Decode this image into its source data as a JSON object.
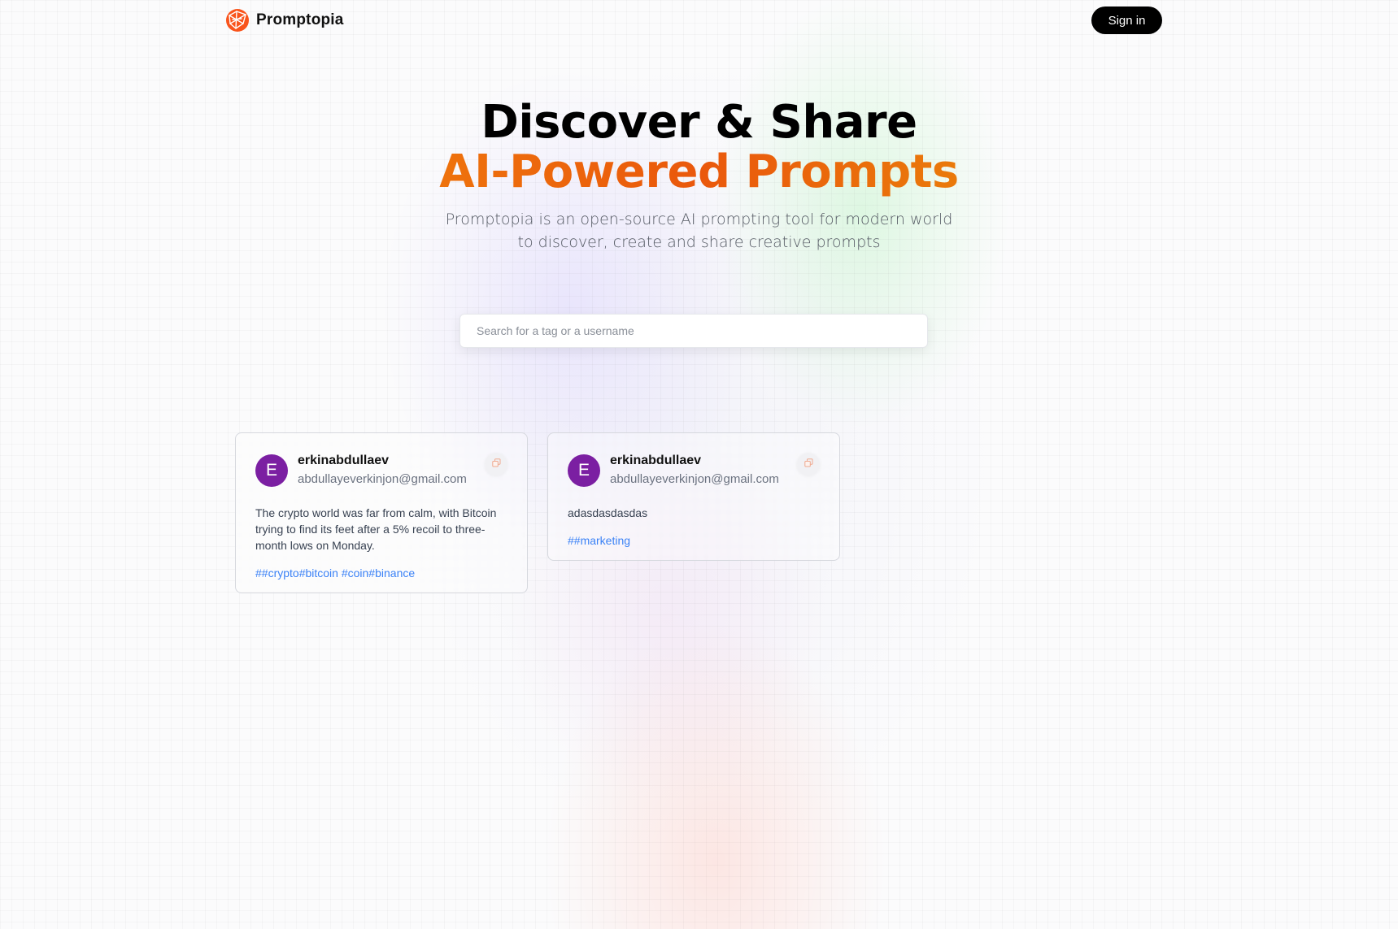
{
  "nav": {
    "brand_name": "Promptopia",
    "logo_icon": "logo-icon",
    "signin_label": "Sign in"
  },
  "hero": {
    "title_line1": "Discover & Share",
    "title_line2": "AI-Powered Prompts",
    "description": "Promptopia is an open-source AI prompting tool for modern world to discover, create and share creative prompts"
  },
  "search": {
    "placeholder": "Search for a tag or a username",
    "value": ""
  },
  "prompts": [
    {
      "avatar_initial": "E",
      "username": "erkinabdullaev",
      "email": "abdullayeverkinjon@gmail.com",
      "prompt": "The crypto world was far from calm, with Bitcoin trying to find its feet after a 5% recoil to three-month lows on Monday.",
      "tags": "##crypto#bitcoin #coin#binance",
      "copy_icon": "copy-icon"
    },
    {
      "avatar_initial": "E",
      "username": "erkinabdullaev",
      "email": "abdullayeverkinjon@gmail.com",
      "prompt": "adasdasdasdas",
      "tags": "##marketing",
      "copy_icon": "copy-icon"
    }
  ],
  "colors": {
    "accent_gradient_start": "#f59e0b",
    "accent_gradient_mid": "#ea580c",
    "accent_gradient_end": "#eab308",
    "avatar_bg": "#7b1fa2",
    "tag_color": "#3b82f6",
    "button_bg": "#000000"
  }
}
